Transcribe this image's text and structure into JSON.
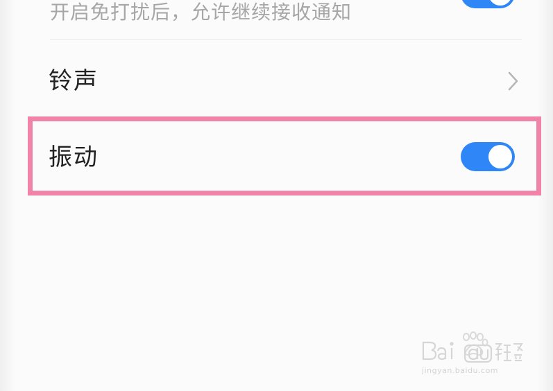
{
  "settings": {
    "dnd_notify_subtitle": "开启免打扰后，允许继续接收通知",
    "ringtone_label": "铃声",
    "vibrate_label": "振动"
  },
  "toggles": {
    "dnd_notify_enabled": true,
    "vibrate_enabled": true
  },
  "icons": {
    "ringtone_chevron": "chevron-right-icon"
  },
  "colors": {
    "toggle_on": "#2f86f6",
    "highlight": "#f183a8",
    "primary_text": "#222222",
    "secondary_text": "#a6a6a6"
  },
  "watermark": {
    "url": "jingyan.baidu.com"
  }
}
